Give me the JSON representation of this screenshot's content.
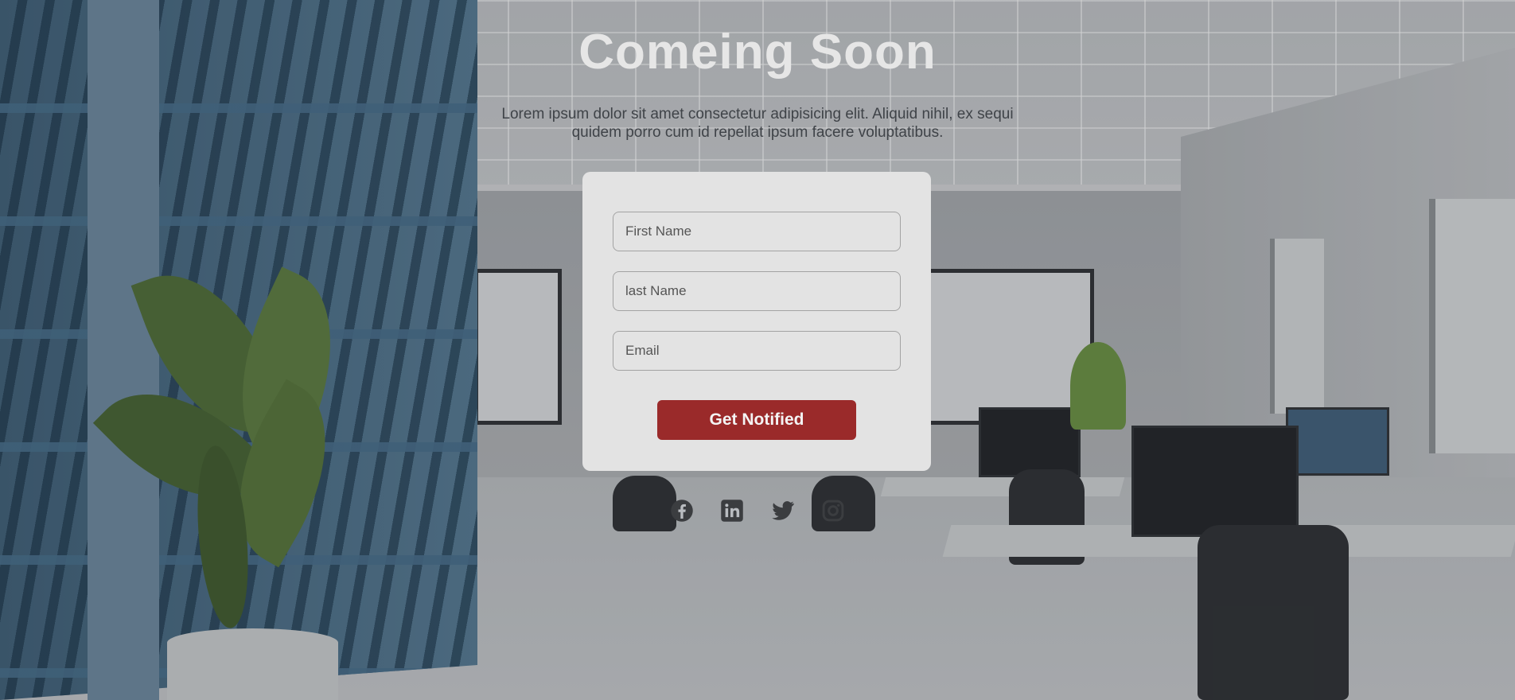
{
  "page": {
    "title": "Comeing Soon",
    "description": "Lorem ipsum dolor sit amet consectetur adipisicing elit. Aliquid nihil, ex sequi quidem porro cum id repellat ipsum facere voluptatibus."
  },
  "form": {
    "first_name_placeholder": "First Name",
    "first_name_value": "",
    "last_name_placeholder": "last Name",
    "last_name_value": "",
    "email_placeholder": "Email",
    "email_value": "",
    "submit_label": "Get Notified"
  },
  "social": {
    "items": [
      {
        "icon": "facebook-icon"
      },
      {
        "icon": "linkedin-icon"
      },
      {
        "icon": "twitter-icon"
      },
      {
        "icon": "instagram-icon"
      }
    ]
  },
  "colors": {
    "accent": "#9a2a2a",
    "card": "#e3e3e3",
    "title": "#e6e6e6",
    "icon": "#3b3d40"
  }
}
